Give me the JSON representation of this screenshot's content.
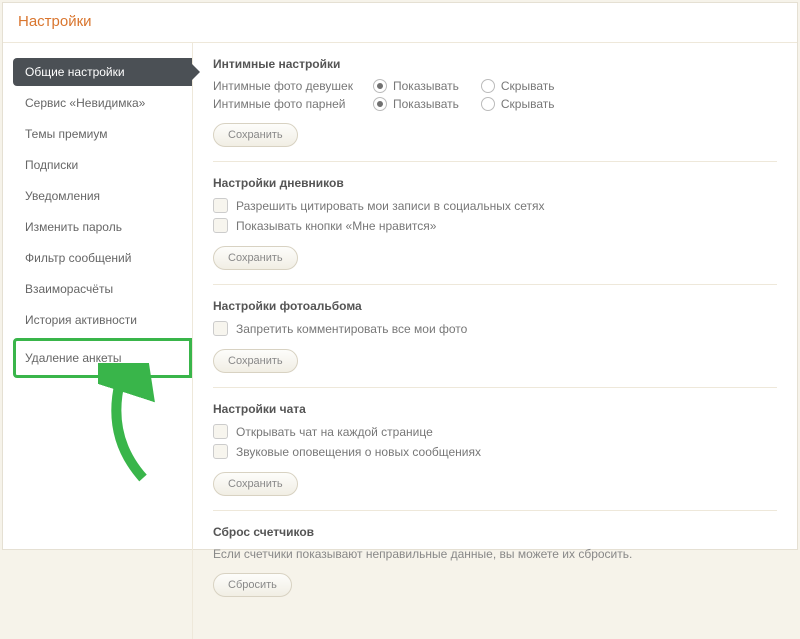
{
  "header": {
    "title": "Настройки"
  },
  "sidebar": {
    "items": [
      {
        "label": "Общие настройки",
        "active": true
      },
      {
        "label": "Сервис «Невидимка»"
      },
      {
        "label": "Темы премиум"
      },
      {
        "label": "Подписки"
      },
      {
        "label": "Уведомления"
      },
      {
        "label": "Изменить пароль"
      },
      {
        "label": "Фильтр сообщений"
      },
      {
        "label": "Взаиморасчёты"
      },
      {
        "label": "История активности"
      },
      {
        "label": "Удаление анкеты",
        "highlighted": true
      }
    ]
  },
  "sections": {
    "intimate": {
      "title": "Интимные настройки",
      "row1_label": "Интимные фото девушек",
      "row2_label": "Интимные фото парней",
      "show": "Показывать",
      "hide": "Скрывать",
      "save": "Сохранить"
    },
    "diaries": {
      "title": "Настройки дневников",
      "cb1": "Разрешить цитировать мои записи в социальных сетях",
      "cb2": "Показывать кнопки «Мне нравится»",
      "save": "Сохранить"
    },
    "photo": {
      "title": "Настройки фотоальбома",
      "cb1": "Запретить комментировать все мои фото",
      "save": "Сохранить"
    },
    "chat": {
      "title": "Настройки чата",
      "cb1": "Открывать чат на каждой странице",
      "cb2": "Звуковые оповещения о новых сообщениях",
      "save": "Сохранить"
    },
    "counters": {
      "title": "Сброс счетчиков",
      "desc": "Если счетчики показывают неправильные данные, вы можете их сбросить.",
      "reset": "Сбросить"
    }
  }
}
